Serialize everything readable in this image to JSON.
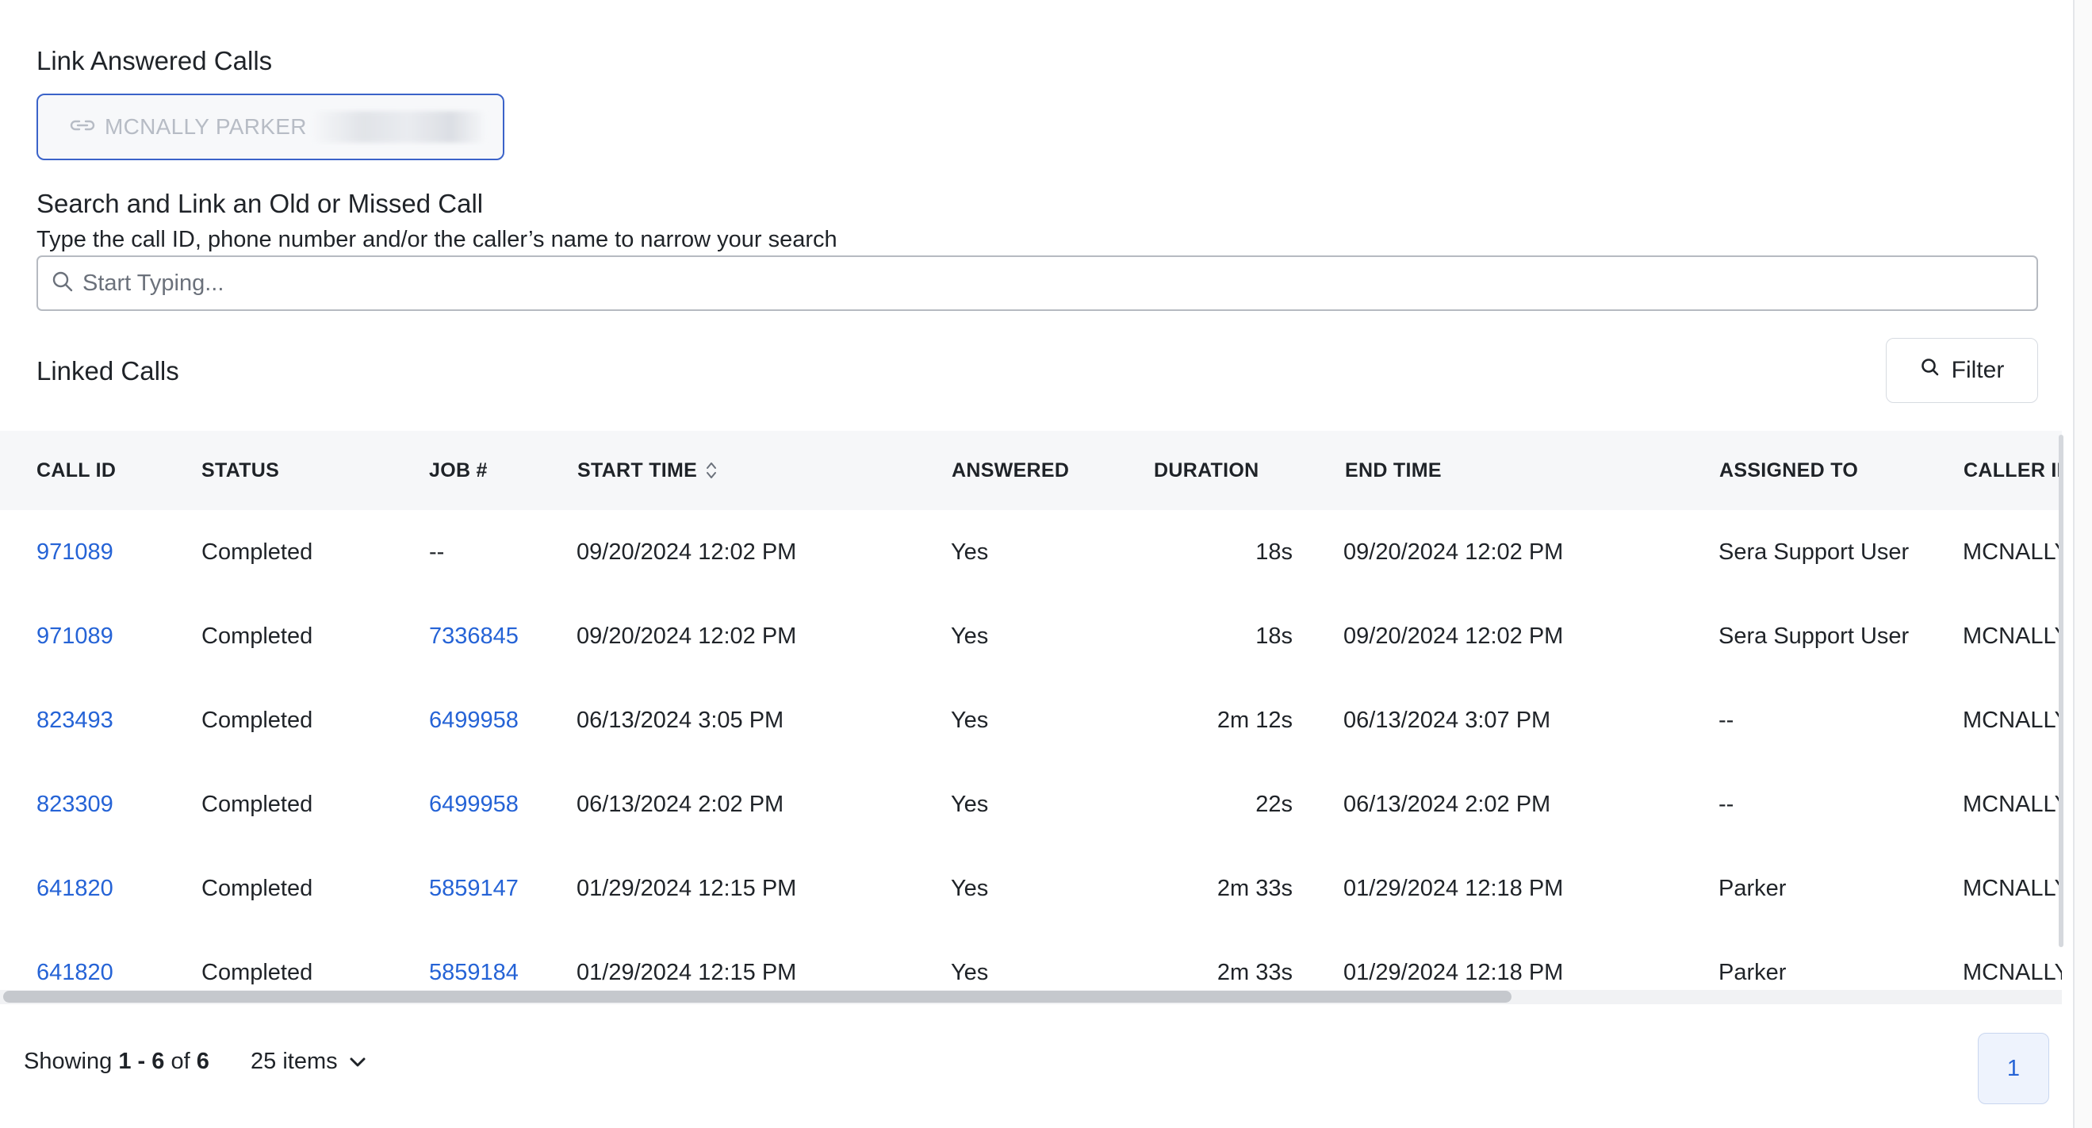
{
  "link_section": {
    "title": "Link Answered Calls",
    "button_label": "MCNALLY PARKER"
  },
  "search_section": {
    "title": "Search and Link an Old or Missed Call",
    "description": "Type the call ID, phone number and/or the caller’s name to narrow your search",
    "placeholder": "Start Typing..."
  },
  "linked_calls": {
    "title": "Linked Calls",
    "filter_label": "Filter"
  },
  "table": {
    "headers": {
      "call_id": "CALL ID",
      "status": "STATUS",
      "job": "JOB #",
      "start_time": "START TIME",
      "answered": "ANSWERED",
      "duration": "DURATION",
      "end_time": "END TIME",
      "assigned_to": "ASSIGNED TO",
      "caller_id": "CALLER ID"
    },
    "rows": [
      {
        "call_id": "971089",
        "status": "Completed",
        "job": "--",
        "start_time": "09/20/2024 12:02 PM",
        "answered": "Yes",
        "duration": "18s",
        "end_time": "09/20/2024 12:02 PM",
        "assigned_to": "Sera Support User",
        "caller_id": "MCNALLY"
      },
      {
        "call_id": "971089",
        "status": "Completed",
        "job": "7336845",
        "start_time": "09/20/2024 12:02 PM",
        "answered": "Yes",
        "duration": "18s",
        "end_time": "09/20/2024 12:02 PM",
        "assigned_to": "Sera Support User",
        "caller_id": "MCNALLY"
      },
      {
        "call_id": "823493",
        "status": "Completed",
        "job": "6499958",
        "start_time": "06/13/2024 3:05 PM",
        "answered": "Yes",
        "duration": "2m 12s",
        "end_time": "06/13/2024 3:07 PM",
        "assigned_to": "--",
        "caller_id": "MCNALLY"
      },
      {
        "call_id": "823309",
        "status": "Completed",
        "job": "6499958",
        "start_time": "06/13/2024 2:02 PM",
        "answered": "Yes",
        "duration": "22s",
        "end_time": "06/13/2024 2:02 PM",
        "assigned_to": "--",
        "caller_id": "MCNALLY"
      },
      {
        "call_id": "641820",
        "status": "Completed",
        "job": "5859147",
        "start_time": "01/29/2024 12:15 PM",
        "answered": "Yes",
        "duration": "2m 33s",
        "end_time": "01/29/2024 12:18 PM",
        "assigned_to": "Parker",
        "caller_id": "MCNALLY"
      },
      {
        "call_id": "641820",
        "status": "Completed",
        "job": "5859184",
        "start_time": "01/29/2024 12:15 PM",
        "answered": "Yes",
        "duration": "2m 33s",
        "end_time": "01/29/2024 12:18 PM",
        "assigned_to": "Parker",
        "caller_id": "MCNALLY"
      }
    ]
  },
  "footer": {
    "showing_prefix": "Showing",
    "range_start": "1",
    "range_sep": "-",
    "range_end": "6",
    "of_label": "of",
    "total": "6",
    "items_per_page": "25 items",
    "current_page": "1"
  },
  "colors": {
    "link": "#2563d6",
    "header_bg": "#f6f7f9",
    "button_border": "#3b63c9"
  },
  "icons": [
    "link-icon",
    "search-icon",
    "chevron-down-icon",
    "sort-icon"
  ]
}
